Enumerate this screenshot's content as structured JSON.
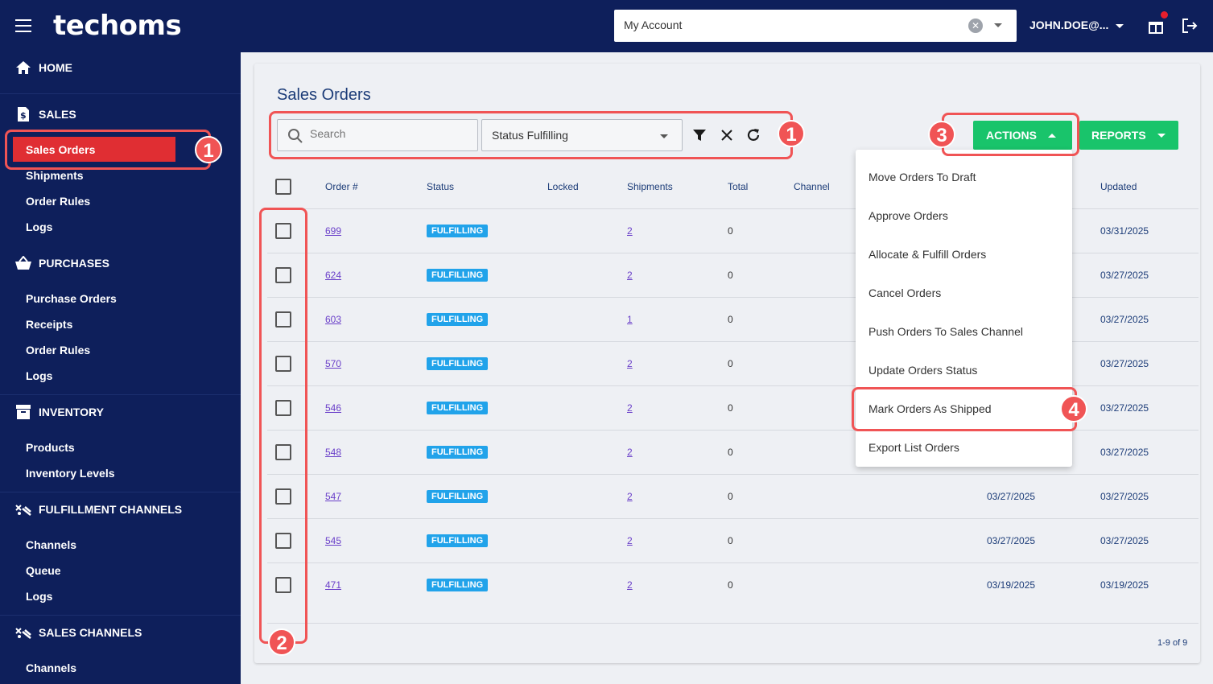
{
  "app": {
    "logo": "techoms"
  },
  "topbar": {
    "account_value": "My Account",
    "user": "JOHN.DOE@...",
    "clear_glyph": "✕"
  },
  "sidebar": {
    "sections": [
      {
        "label": "HOME",
        "icon": "home-icon"
      },
      {
        "label": "SALES",
        "icon": "dollar-doc-icon",
        "items": [
          "Sales Orders",
          "Shipments",
          "Order Rules",
          "Logs"
        ]
      },
      {
        "label": "PURCHASES",
        "icon": "basket-icon",
        "items": [
          "Purchase Orders",
          "Receipts",
          "Order Rules",
          "Logs"
        ]
      },
      {
        "label": "INVENTORY",
        "icon": "archive-icon",
        "items": [
          "Products",
          "Inventory Levels"
        ]
      },
      {
        "label": "FULFILLMENT CHANNELS",
        "icon": "channels-icon",
        "items": [
          "Channels",
          "Queue",
          "Logs"
        ]
      },
      {
        "label": "SALES CHANNELS",
        "icon": "channels-icon",
        "items": [
          "Channels"
        ]
      }
    ],
    "active_item": "Sales Orders"
  },
  "main": {
    "title": "Sales Orders",
    "search_placeholder": "Search",
    "status_filter": "Status Fulfilling",
    "actions_label": "ACTIONS",
    "reports_label": "REPORTS",
    "pagination": "1-9 of 9"
  },
  "table": {
    "columns": [
      "Order #",
      "Status",
      "Locked",
      "Shipments",
      "Total",
      "Channel",
      "Updated"
    ],
    "rows": [
      {
        "order": "699",
        "status": "FULFILLING",
        "shipments": "2",
        "total": "0",
        "created": "",
        "updated": "03/31/2025"
      },
      {
        "order": "624",
        "status": "FULFILLING",
        "shipments": "2",
        "total": "0",
        "created": "",
        "updated": "03/27/2025"
      },
      {
        "order": "603",
        "status": "FULFILLING",
        "shipments": "1",
        "total": "0",
        "created": "",
        "updated": "03/27/2025"
      },
      {
        "order": "570",
        "status": "FULFILLING",
        "shipments": "2",
        "total": "0",
        "created": "",
        "updated": "03/27/2025"
      },
      {
        "order": "546",
        "status": "FULFILLING",
        "shipments": "2",
        "total": "0",
        "created": "",
        "updated": "03/27/2025"
      },
      {
        "order": "548",
        "status": "FULFILLING",
        "shipments": "2",
        "total": "0",
        "created": "",
        "updated": "03/27/2025"
      },
      {
        "order": "547",
        "status": "FULFILLING",
        "shipments": "2",
        "total": "0",
        "created": "03/27/2025",
        "updated": "03/27/2025"
      },
      {
        "order": "545",
        "status": "FULFILLING",
        "shipments": "2",
        "total": "0",
        "created": "03/27/2025",
        "updated": "03/27/2025"
      },
      {
        "order": "471",
        "status": "FULFILLING",
        "shipments": "2",
        "total": "0",
        "created": "03/19/2025",
        "updated": "03/19/2025"
      }
    ]
  },
  "actions_menu": [
    "Move Orders To Draft",
    "Approve Orders",
    "Allocate & Fulfill Orders",
    "Cancel Orders",
    "Push Orders To Sales Channel",
    "Update Orders Status",
    "Mark Orders As Shipped",
    "Export List Orders"
  ],
  "annotations": [
    "1",
    "1",
    "2",
    "3",
    "4"
  ],
  "colors": {
    "navy": "#0e1f5b",
    "active_red": "#e02e33",
    "annotation_red": "#f05455",
    "action_green": "#19c46b",
    "badge_blue": "#21a3ea",
    "link_purple": "#6a3fc9"
  }
}
